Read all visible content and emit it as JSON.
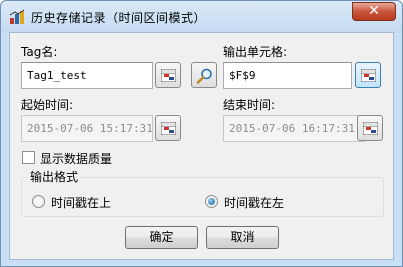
{
  "window": {
    "title": "历史存储记录（时间区间模式）",
    "close_glyph": "✕"
  },
  "fields": {
    "tag_label": "Tag名:",
    "tag_value": "Tag1_test",
    "output_cell_label": "输出单元格:",
    "output_cell_value": "$F$9",
    "start_time_label": "起始时间:",
    "start_time_value": "2015-07-06 15:17:31",
    "end_time_label": "结束时间:",
    "end_time_value": "2015-07-06 16:17:31"
  },
  "options": {
    "show_quality_label": "显示数据质量",
    "show_quality_checked": false
  },
  "output_format": {
    "title": "输出格式",
    "choices": [
      {
        "label": "时间戳在上",
        "selected": false
      },
      {
        "label": "时间戳在左",
        "selected": true
      }
    ]
  },
  "buttons": {
    "ok": "确定",
    "cancel": "取消"
  },
  "icons": {
    "app": "database-icon",
    "picker": "cell-picker-icon",
    "search": "magnifier-icon"
  }
}
